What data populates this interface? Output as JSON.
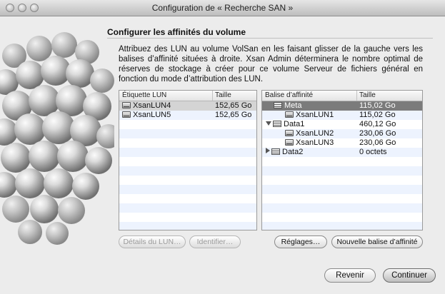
{
  "window": {
    "title": "Configuration de « Recherche SAN »"
  },
  "header": {
    "title": "Configurer les affinités du volume"
  },
  "description": "Attribuez des LUN au volume VolSan en les faisant glisser de la gauche vers les balises d’affinité situées à droite. Xsan Admin déterminera le nombre optimal de réserves de stockage à créer pour ce volume Serveur de fichiers général en fonction du mode d’attribution des LUN.",
  "lun_table": {
    "columns": [
      "Étiquette LUN",
      "Taille"
    ],
    "rows": [
      {
        "label": "XsanLUN4",
        "size": "152,65 Go",
        "icon": "disk-icon"
      },
      {
        "label": "XsanLUN5",
        "size": "152,65 Go",
        "icon": "disk-icon"
      }
    ]
  },
  "affinity_table": {
    "columns": [
      "Balise d’affinité",
      "Taille"
    ],
    "rows": [
      {
        "label": "Meta",
        "size": "115,02 Go",
        "icon": "storage-pool-icon"
      },
      {
        "label": "XsanLUN1",
        "size": "115,02 Go",
        "icon": "disk-icon"
      },
      {
        "label": "Data1",
        "size": "460,12 Go",
        "icon": "storage-pool-icon",
        "disclosure": "expanded"
      },
      {
        "label": "XsanLUN2",
        "size": "230,06 Go",
        "icon": "disk-icon"
      },
      {
        "label": "XsanLUN3",
        "size": "230,06 Go",
        "icon": "disk-icon"
      },
      {
        "label": "Data2",
        "size": "0 octets",
        "icon": "storage-pool-icon",
        "disclosure": "collapsed"
      }
    ]
  },
  "buttons": {
    "lun_details": "Détails du LUN…",
    "identify": "Identifier…",
    "settings": "Réglages…",
    "new_affinity_tag": "Nouvelle balise d’affinité",
    "back": "Revenir",
    "continue": "Continuer"
  }
}
